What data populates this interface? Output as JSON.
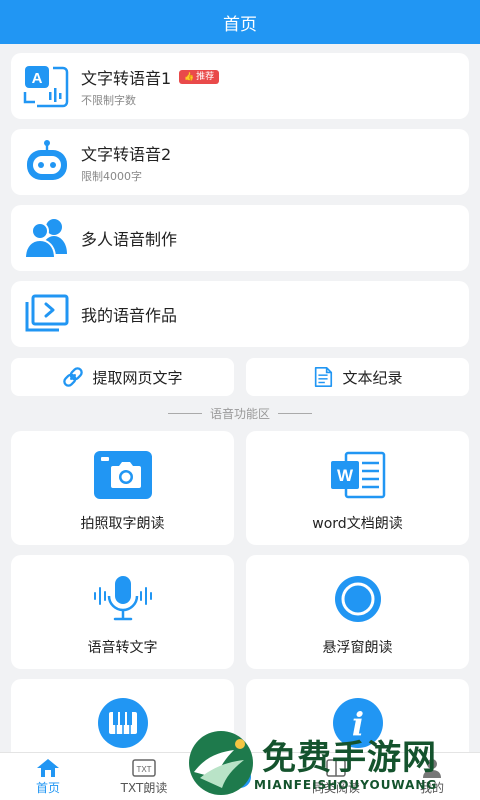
{
  "header": {
    "title": "首页"
  },
  "cards": [
    {
      "title": "文字转语音1",
      "badge": "推荐",
      "subtitle": "不限制字数",
      "icon": "tts-a-icon"
    },
    {
      "title": "文字转语音2",
      "subtitle": "限制4000字",
      "icon": "robot-icon"
    },
    {
      "title": "多人语音制作",
      "icon": "people-icon"
    },
    {
      "title": "我的语音作品",
      "icon": "folder-play-icon"
    }
  ],
  "quick": [
    {
      "label": "提取网页文字",
      "icon": "link-icon"
    },
    {
      "label": "文本纪录",
      "icon": "document-icon"
    }
  ],
  "section_title": "语音功能区",
  "tiles": [
    {
      "label": "拍照取字朗读",
      "icon": "camera-icon"
    },
    {
      "label": "word文档朗读",
      "icon": "word-icon",
      "icon_text": "W"
    },
    {
      "label": "语音转文字",
      "icon": "microphone-icon"
    },
    {
      "label": "悬浮窗朗读",
      "icon": "floating-circle-icon"
    },
    {
      "label": "",
      "icon": "piano-icon"
    },
    {
      "label": "",
      "icon": "info-icon",
      "icon_text": "i"
    }
  ],
  "bottom_nav": [
    {
      "label": "首页",
      "icon": "home-icon",
      "active": true
    },
    {
      "label": "TXT朗读",
      "icon": "txt-icon",
      "icon_text": "TXT"
    },
    {
      "label": "",
      "icon": "add-icon"
    },
    {
      "label": "同类阅读",
      "icon": "book-icon"
    },
    {
      "label": "我的",
      "icon": "user-icon"
    }
  ],
  "watermark": {
    "title": "免费手游网",
    "subtitle": "MIANFEISHOUYOUWANG"
  },
  "colors": {
    "primary": "#2196f3",
    "badge": "#e94a4a",
    "background": "#f1f2f4"
  }
}
